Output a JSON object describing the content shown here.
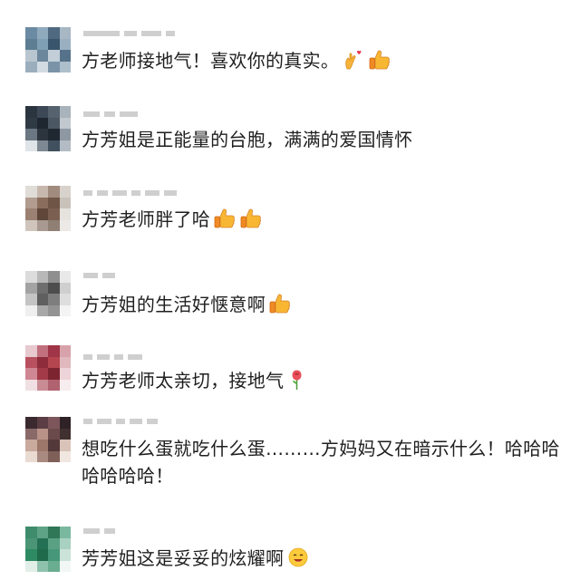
{
  "comments": [
    {
      "text": "方老师接地气！喜欢你的真实。",
      "emoji": [
        "hand-heart-emoji",
        "thumbs-up-emoji"
      ],
      "avatar": [
        "#6b8aa3",
        "#8fa9bd",
        "#4f6a80",
        "#a7b7c4",
        "#5d7d92",
        "#7f9fb5",
        "#38556c",
        "#9ab0c0",
        "#b9c6cf",
        "#6c879b",
        "#c3cfd8",
        "#56728a",
        "#9aaebd",
        "#d2dbe2",
        "#7a93a7",
        "#aebfcc"
      ]
    },
    {
      "text": "方芳姐是正能量的台胞，满满的爱国情怀",
      "emoji": [],
      "avatar": [
        "#2b3540",
        "#3c4856",
        "#56636f",
        "#a9b3bb",
        "#303a44",
        "#1e2630",
        "#4b5864",
        "#c1c9cf",
        "#6b7782",
        "#2c343e",
        "#1f2731",
        "#8d98a2",
        "#dfe4e8",
        "#7d8893",
        "#40505e",
        "#b3bcc4"
      ]
    },
    {
      "text": "方芳老师胖了哈",
      "emoji": [
        "thumbs-up-emoji",
        "thumbs-up-emoji"
      ],
      "avatar": [
        "#e0dcd8",
        "#c7b8ad",
        "#a08b7e",
        "#d8d2cc",
        "#b19c8f",
        "#8a6d5c",
        "#6f5545",
        "#c9c2bb",
        "#9b8172",
        "#5e4639",
        "#7b6052",
        "#e6e2de",
        "#cfc5bd",
        "#a89a90",
        "#8f7f74",
        "#ece9e6"
      ]
    },
    {
      "text": "方芳姐的生活好惬意啊",
      "emoji": [
        "thumbs-up-emoji"
      ],
      "avatar": [
        "#dcdcdc",
        "#b8b8b8",
        "#8f8f8f",
        "#e9e9e9",
        "#a3a3a3",
        "#6e6e6e",
        "#4d4d4d",
        "#cfcfcf",
        "#c4c4c4",
        "#5f5f5f",
        "#7e7e7e",
        "#dedede",
        "#efefef",
        "#a8a8a8",
        "#939393",
        "#f4f4f4"
      ]
    },
    {
      "text": "方芳老师太亲切，接地气",
      "emoji": [
        "rose-emoji"
      ],
      "avatar": [
        "#e7c9cf",
        "#c2707d",
        "#9f3546",
        "#d8a2ab",
        "#b8505f",
        "#8e2c3b",
        "#b5454f",
        "#e0b8be",
        "#cf8793",
        "#a33a48",
        "#7d2431",
        "#edd4d8",
        "#f0e0e3",
        "#c98b94",
        "#b06270",
        "#f7ecee"
      ]
    },
    {
      "text": "想吃什么蛋就吃什么蛋………方妈妈又在暗示什么！哈哈哈哈哈哈哈！",
      "emoji": [],
      "avatar": [
        "#3a2a30",
        "#5b3d44",
        "#7c565a",
        "#2e2226",
        "#8a6a68",
        "#b99287",
        "#6b4a4c",
        "#40302f",
        "#c9aa9d",
        "#9d7769",
        "#53393a",
        "#d9c3b8",
        "#eadbd2",
        "#a98a80",
        "#7f6059",
        "#f1e6e0"
      ]
    },
    {
      "text": "芳芳姐这是妥妥的炫耀啊",
      "emoji": [
        "smiling-face-emoji"
      ],
      "avatar": [
        "#3f8c6c",
        "#5fa387",
        "#2f7757",
        "#7bb8a0",
        "#4b9576",
        "#237055",
        "#5aa184",
        "#a8d1c1",
        "#2d8a62",
        "#1f6a4a",
        "#47977a",
        "#cbe3d9",
        "#e2efe9",
        "#8fc2ad",
        "#6aad91",
        "#f1f7f4"
      ]
    }
  ]
}
